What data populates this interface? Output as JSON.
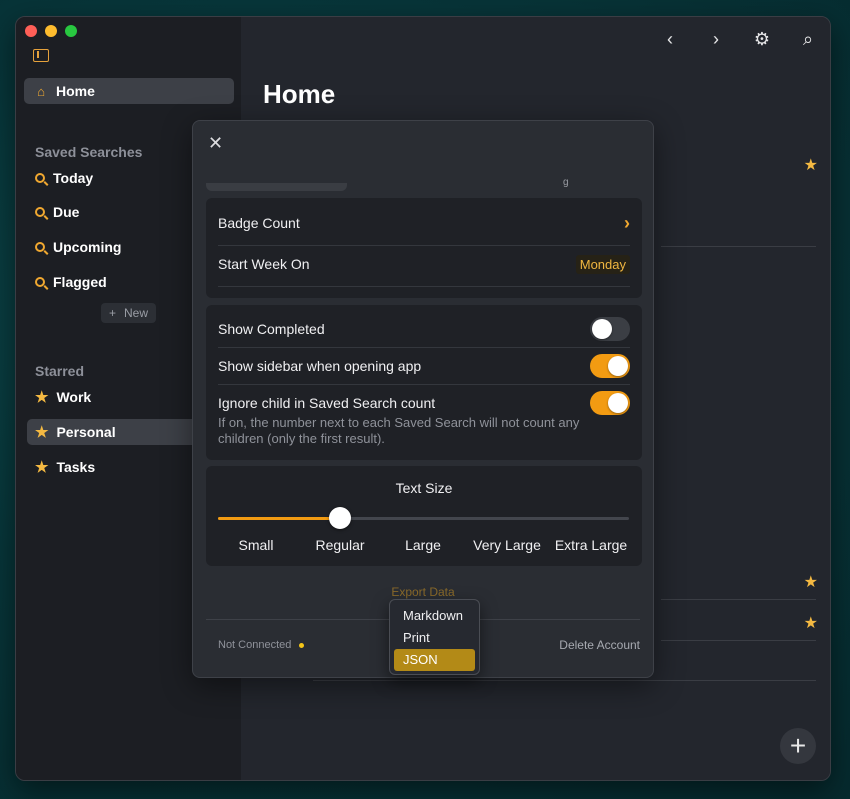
{
  "window": {
    "traffic_lights": {
      "close": "#ff5f57",
      "minimize": "#febc2e",
      "zoom": "#28c840"
    }
  },
  "sidebar": {
    "home_label": "Home",
    "saved_searches_title": "Saved Searches",
    "saved_searches": [
      {
        "label": "Today",
        "icon": "search-icon"
      },
      {
        "label": "Due",
        "icon": "search-icon"
      },
      {
        "label": "Upcoming",
        "icon": "search-icon"
      },
      {
        "label": "Flagged",
        "icon": "search-icon"
      }
    ],
    "new_button": "New",
    "starred_title": "Starred",
    "starred": [
      {
        "label": "Work",
        "icon": "star-icon"
      },
      {
        "label": "Personal",
        "icon": "star-icon",
        "selected": true
      },
      {
        "label": "Tasks",
        "icon": "star-icon"
      }
    ]
  },
  "main": {
    "title": "Home",
    "toolbar": [
      "back-icon",
      "forward-icon",
      "settings-icon",
      "search-icon"
    ],
    "add_button": "+"
  },
  "settings": {
    "close_label": "✕",
    "badge_count_label": "Badge Count",
    "start_week_label": "Start Week On",
    "start_week_value": "Monday",
    "show_completed_label": "Show Completed",
    "show_completed_on": false,
    "show_sidebar_label": "Show sidebar when opening app",
    "show_sidebar_on": true,
    "ignore_child_label": "Ignore child in Saved Search count",
    "ignore_child_on": true,
    "ignore_child_desc": "If on, the number next to each Saved Search will not count any children (only the first result).",
    "text_size": {
      "title": "Text Size",
      "options": [
        "Small",
        "Regular",
        "Large",
        "Very Large",
        "Extra Large"
      ],
      "selected": "Regular",
      "selected_index": 1
    },
    "export_label": "Export Data",
    "connection_status": "Not Connected",
    "delete_account_label": "Delete Account"
  },
  "export_menu": {
    "items": [
      "Markdown",
      "Print",
      "JSON"
    ],
    "selected": "JSON"
  },
  "colors": {
    "accent": "#f29b12",
    "star": "#f4b942",
    "menu_selected": "#b38a17",
    "background": "#23262d"
  }
}
